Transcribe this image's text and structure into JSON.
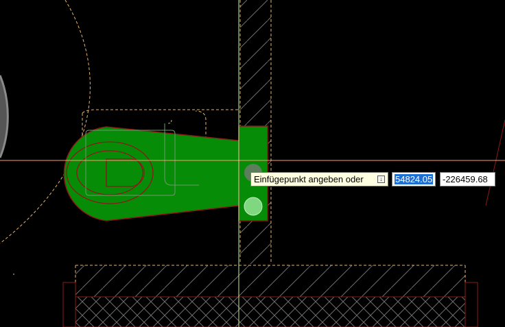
{
  "prompt": {
    "text": "Einfügepunkt angeben oder",
    "options_icon": "arrow-down-options-icon"
  },
  "coordinates": {
    "x_value": "54824.05",
    "y_value": "-226459.68"
  },
  "colors": {
    "background": "#000000",
    "fill_green": "#078c07",
    "outline_red": "#8b1a1a",
    "dashed_orange": "#e8b46a",
    "crosshair_orange": "#ff9a6e",
    "crosshair_green": "#c8f0a0",
    "hatch_gray": "#6a6a6a",
    "selection_blue": "#1e6fd0"
  }
}
